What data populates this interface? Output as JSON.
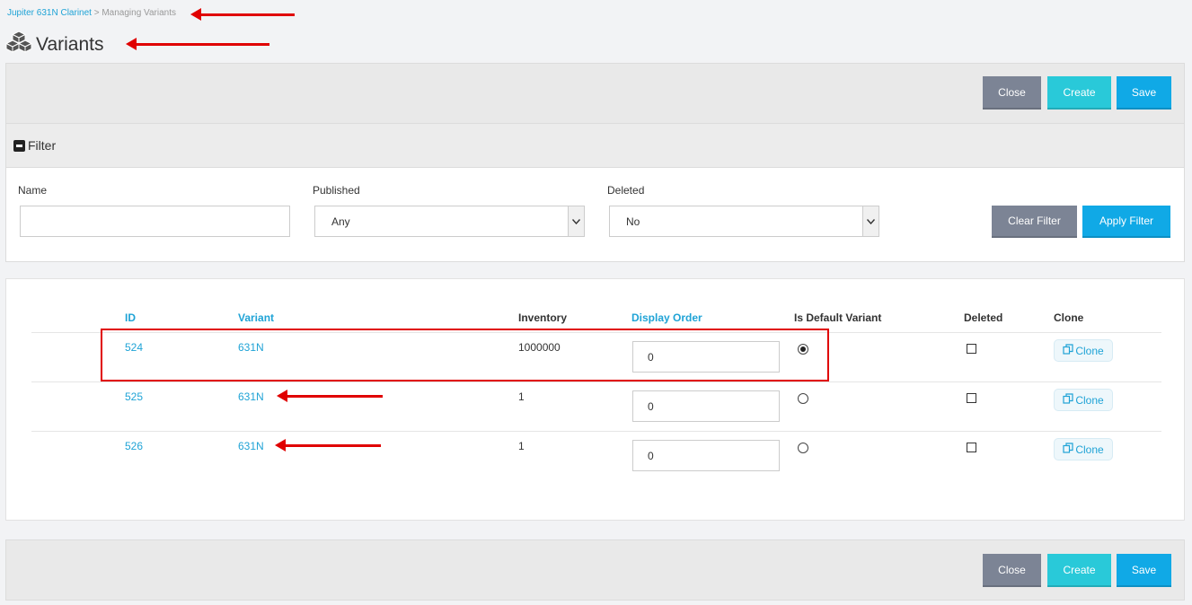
{
  "breadcrumb": {
    "parent": "Jupiter 631N Clarinet",
    "separator": " > ",
    "current": "Managing Variants"
  },
  "page": {
    "title": "Variants",
    "icon": "cubes-icon"
  },
  "toolbar": {
    "close_label": "Close",
    "create_label": "Create",
    "save_label": "Save"
  },
  "filter": {
    "title": "Filter",
    "name_label": "Name",
    "name_value": "",
    "published_label": "Published",
    "published_value": "Any",
    "deleted_label": "Deleted",
    "deleted_value": "No",
    "clear_label": "Clear Filter",
    "apply_label": "Apply Filter"
  },
  "table": {
    "headers": {
      "id": "ID",
      "variant": "Variant",
      "inventory": "Inventory",
      "display_order": "Display Order",
      "is_default": "Is Default Variant",
      "deleted": "Deleted",
      "clone": "Clone"
    },
    "rows": [
      {
        "id": "524",
        "variant": "631N",
        "inventory": "1000000",
        "display_order": "0",
        "is_default": true,
        "deleted": false,
        "clone_label": "Clone"
      },
      {
        "id": "525",
        "variant": "631N",
        "inventory": "1",
        "display_order": "0",
        "is_default": false,
        "deleted": false,
        "clone_label": "Clone"
      },
      {
        "id": "526",
        "variant": "631N",
        "inventory": "1",
        "display_order": "0",
        "is_default": false,
        "deleted": false,
        "clone_label": "Clone"
      }
    ]
  },
  "colors": {
    "accent": "#1fa3d6",
    "close_button": "#7c8495",
    "create_button": "#29c9d9",
    "save_button": "#10a9e6",
    "annotation_red": "#e00000"
  }
}
